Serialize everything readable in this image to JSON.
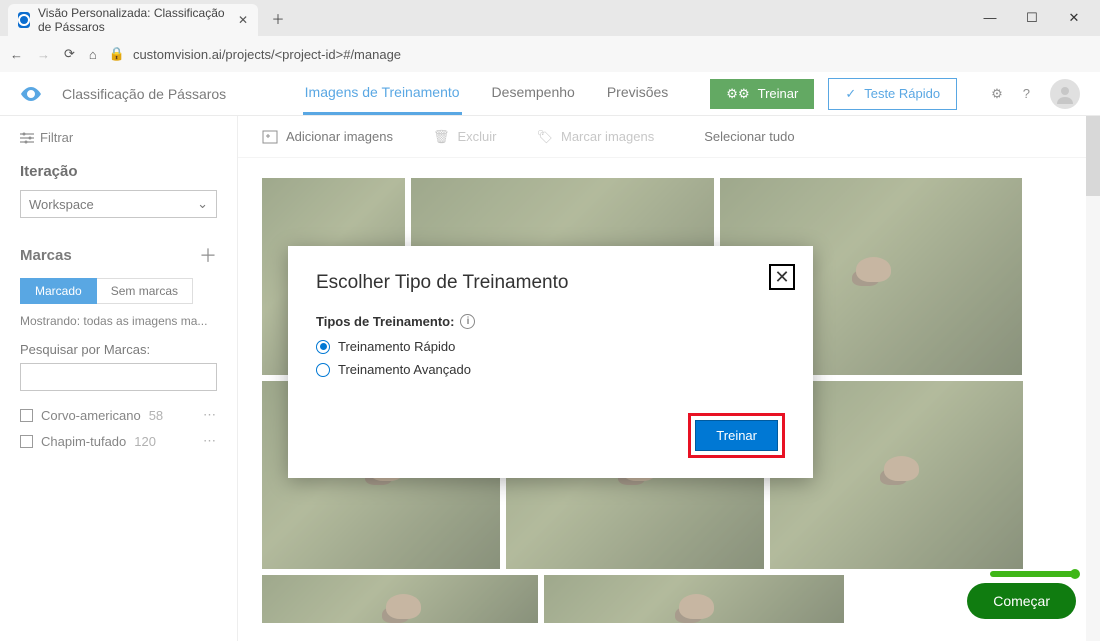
{
  "browser": {
    "tab_title": "Visão Personalizada: Classificação de Pássaros",
    "url": "customvision.ai/projects/<project-id>#/manage"
  },
  "header": {
    "project_name": "Classificação de Pássaros",
    "tabs": {
      "training_images": "Imagens de Treinamento",
      "performance": "Desempenho",
      "predictions": "Previsões"
    },
    "train_button": "Treinar",
    "quick_test_button": "Teste Rápido"
  },
  "sidebar": {
    "filter_label": "Filtrar",
    "iteration_heading": "Iteração",
    "workspace_value": "Workspace",
    "tags_heading": "Marcas",
    "pill_tagged": "Marcado",
    "pill_untagged": "Sem marcas",
    "showing_text": "Mostrando: todas as imagens ma...",
    "search_label": "Pesquisar por Marcas:",
    "tags": [
      {
        "name": "Corvo-americano",
        "count": "58"
      },
      {
        "name": "Chapim-tufado",
        "count": "120"
      }
    ]
  },
  "toolbar": {
    "add_images": "Adicionar imagens",
    "delete": "Excluir",
    "tag_images": "Marcar imagens",
    "select_all": "Selecionar tudo"
  },
  "modal": {
    "title": "Escolher Tipo de Treinamento",
    "types_label": "Tipos de Treinamento:",
    "option_quick": "Treinamento Rápido",
    "option_advanced": "Treinamento Avançado",
    "train_button": "Treinar"
  },
  "fab": {
    "label": "Começar"
  }
}
